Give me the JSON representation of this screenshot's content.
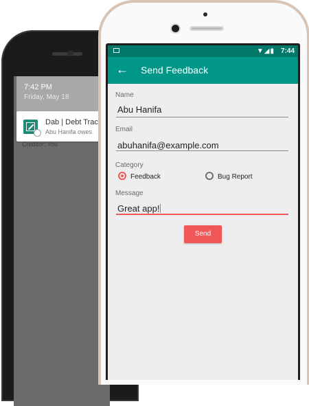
{
  "lockscreen": {
    "time": "7:42 PM",
    "date": "Friday, May 18",
    "notification": {
      "title": "Dab | Debt Track",
      "text": "Abu Hanifa owes",
      "subtext": "Creditor: You",
      "icon": "chart-app-icon"
    }
  },
  "statusbar": {
    "time": "7:44",
    "icons": "▼◢▮"
  },
  "appbar": {
    "back_icon": "←",
    "title": "Send Feedback"
  },
  "form": {
    "name_label": "Name",
    "name_value": "Abu Hanifa",
    "email_label": "Email",
    "email_value": "abuhanifa@example.com",
    "category_label": "Category",
    "category_options": [
      "Feedback",
      "Bug Report"
    ],
    "category_selected": "Feedback",
    "message_label": "Message",
    "message_value": "Great app!",
    "send_label": "Send"
  },
  "colors": {
    "primary": "#009688",
    "primary_dark": "#00796b",
    "accent": "#f25757"
  }
}
